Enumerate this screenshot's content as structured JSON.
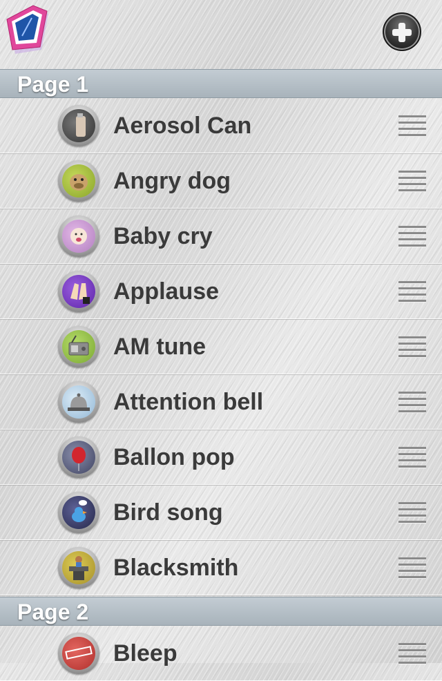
{
  "header": {
    "logo_icon": "blue-pink-card-logo-icon",
    "add_icon": "plus-circle-icon"
  },
  "sections": [
    {
      "title": "Page 1",
      "items": [
        {
          "label": "Aerosol Can",
          "icon": "aerosol-can-icon",
          "icon_color": "#4a4a4a"
        },
        {
          "label": "Angry dog",
          "icon": "angry-dog-icon",
          "icon_color": "#9bb53a"
        },
        {
          "label": "Baby cry",
          "icon": "baby-icon",
          "icon_color": "#c99ad0"
        },
        {
          "label": "Applause",
          "icon": "clapping-hands-icon",
          "icon_color": "#7a3fc7"
        },
        {
          "label": "AM tune",
          "icon": "radio-icon",
          "icon_color": "#8fbf45"
        },
        {
          "label": "Attention bell",
          "icon": "service-bell-icon",
          "icon_color": "#b8d4ea"
        },
        {
          "label": "Ballon pop",
          "icon": "balloon-icon",
          "icon_color": "#5b5f7a"
        },
        {
          "label": "Bird song",
          "icon": "bird-icon",
          "icon_color": "#3c3f6b"
        },
        {
          "label": "Blacksmith",
          "icon": "anvil-icon",
          "icon_color": "#c8b23a"
        }
      ]
    },
    {
      "title": "Page 2",
      "items": [
        {
          "label": "Bleep",
          "icon": "censored-stamp-icon",
          "icon_color": "#d04a45"
        }
      ]
    }
  ]
}
